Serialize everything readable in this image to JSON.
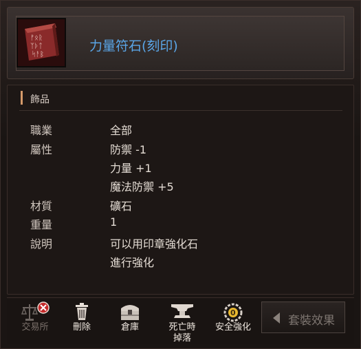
{
  "item": {
    "name": "力量符石(刻印)",
    "icon": "rune-stone-icon",
    "name_color": "#5aa6e8"
  },
  "category": "飾品",
  "stats": {
    "class_label": "職業",
    "class_value": "全部",
    "attr_label": "屬性",
    "attr_values": [
      "防禦 -1",
      "力量 +1",
      "魔法防禦 +5"
    ],
    "material_label": "材質",
    "material_value": "礦石",
    "weight_label": "重量",
    "weight_value": "1",
    "desc_label": "說明",
    "desc_values": [
      "可以用印章強化石",
      "進行強化"
    ]
  },
  "actions": {
    "trade": "交易所",
    "delete": "刪除",
    "storage": "倉庫",
    "death_drop_1": "死亡時",
    "death_drop_2": "掉落",
    "safe_enhance": "安全強化",
    "set_effect": "套裝效果"
  }
}
